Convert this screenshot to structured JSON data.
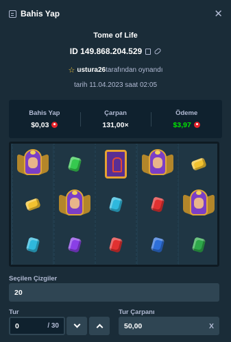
{
  "header": {
    "title": "Bahis Yap",
    "close_icon": "close-icon"
  },
  "game": {
    "title": "Tome of Life",
    "bet_id": "ID 149.868.204.529",
    "username": "ustura26",
    "played_by_suffix": "tarafından oynandı",
    "date_text": "tarih 11.04.2023 saat 02:05"
  },
  "stats": {
    "bet_label": "Bahis Yap",
    "bet_value": "$0,03",
    "multiplier_label": "Çarpan",
    "multiplier_value": "131,00×",
    "payout_label": "Ödeme",
    "payout_value": "$3,97"
  },
  "reels": [
    [
      "pharaoh",
      "gem-yellow",
      "gem-blue"
    ],
    [
      "gem-green",
      "pharaoh",
      "gem-purple"
    ],
    [
      "book",
      "gem-blue",
      "gem-red"
    ],
    [
      "pharaoh",
      "gem-red",
      "gem-darkblue"
    ],
    [
      "gem-yellow",
      "pharaoh",
      "gem-darkgreen"
    ]
  ],
  "controls": {
    "lines_label": "Seçilen Çizgiler",
    "lines_value": "20",
    "rounds_label": "Tur",
    "rounds_value": "0",
    "rounds_max": "/ 30",
    "round_multiplier_label": "Tur Çarpanı",
    "round_multiplier_value": "50,00",
    "round_multiplier_suffix": "X"
  },
  "colors": {
    "background": "#1a2c38",
    "panel": "#0f212e",
    "input": "#2f4553",
    "payout_green": "#00e701",
    "star": "#ffce3a"
  }
}
